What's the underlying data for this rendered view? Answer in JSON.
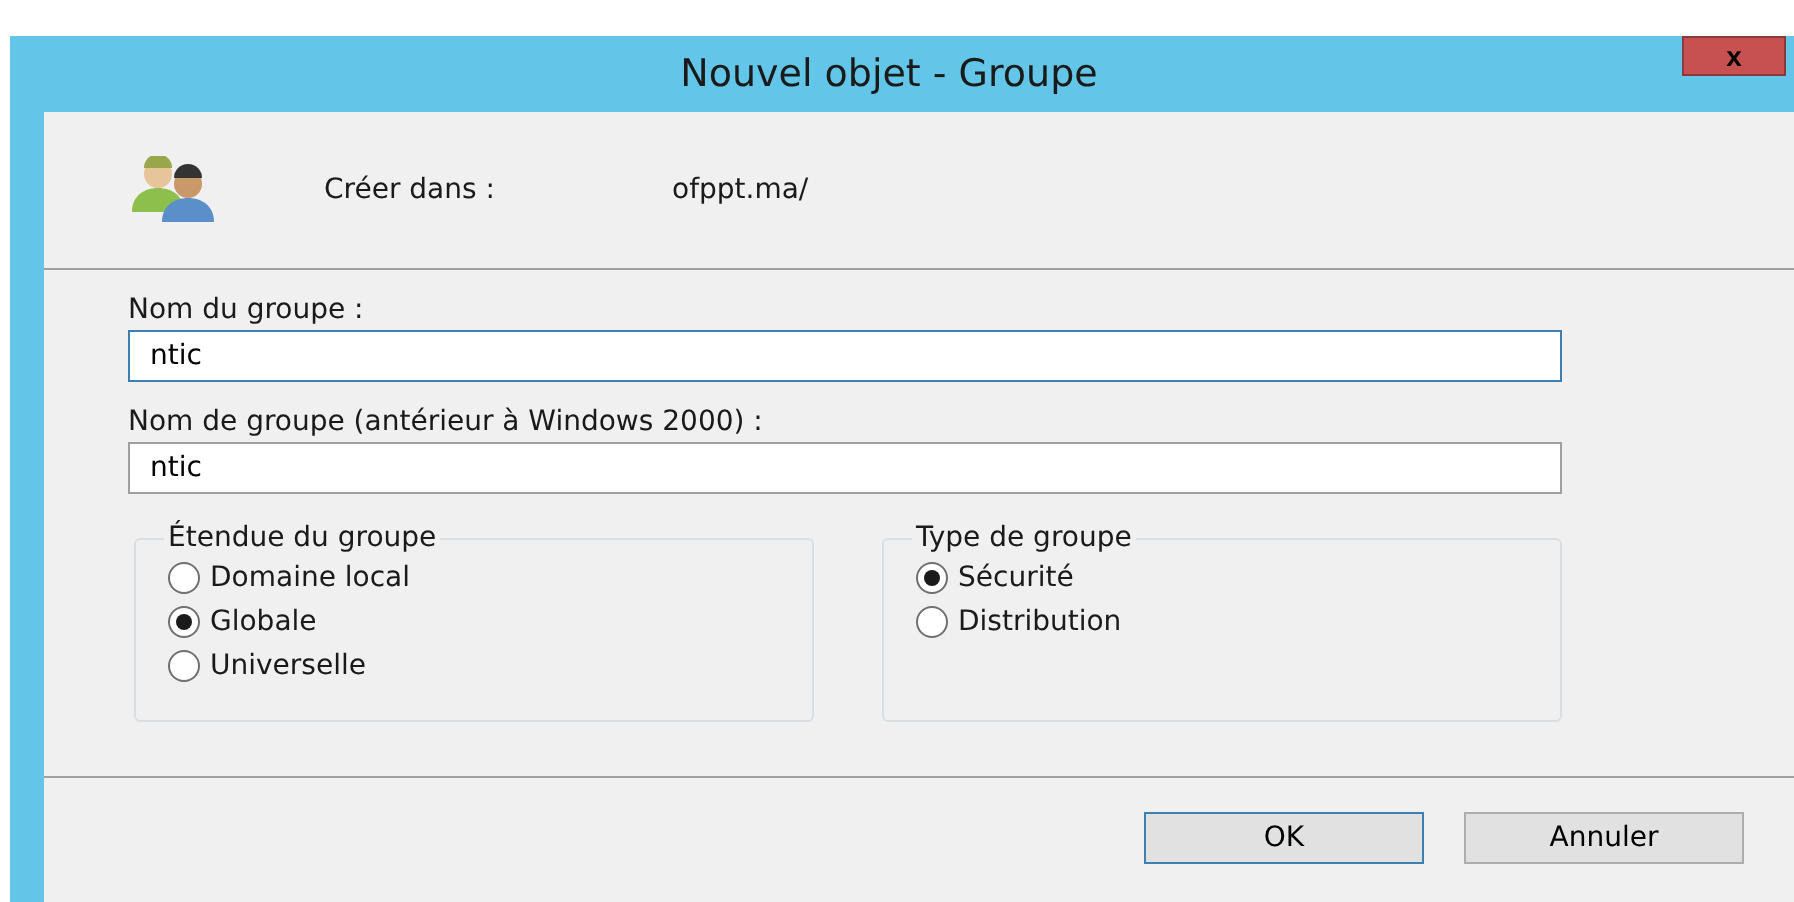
{
  "window": {
    "title": "Nouvel objet - Groupe",
    "close": "x"
  },
  "create_in": {
    "label": "Créer dans :",
    "value": "ofppt.ma/"
  },
  "fields": [
    {
      "label": "Nom du groupe :",
      "value": "ntic"
    },
    {
      "label": "Nom de groupe (antérieur à Windows 2000) :",
      "value": "ntic"
    }
  ],
  "groups": [
    {
      "title": "Étendue du groupe",
      "options": [
        {
          "label": "Domaine local",
          "selected": false
        },
        {
          "label": "Globale",
          "selected": true
        },
        {
          "label": "Universelle",
          "selected": false
        }
      ]
    },
    {
      "title": "Type de groupe",
      "options": [
        {
          "label": "Sécurité",
          "selected": true
        },
        {
          "label": "Distribution",
          "selected": false
        }
      ]
    }
  ],
  "buttons": [
    {
      "label": "OK",
      "default": true
    },
    {
      "label": "Annuler",
      "default": false
    }
  ]
}
